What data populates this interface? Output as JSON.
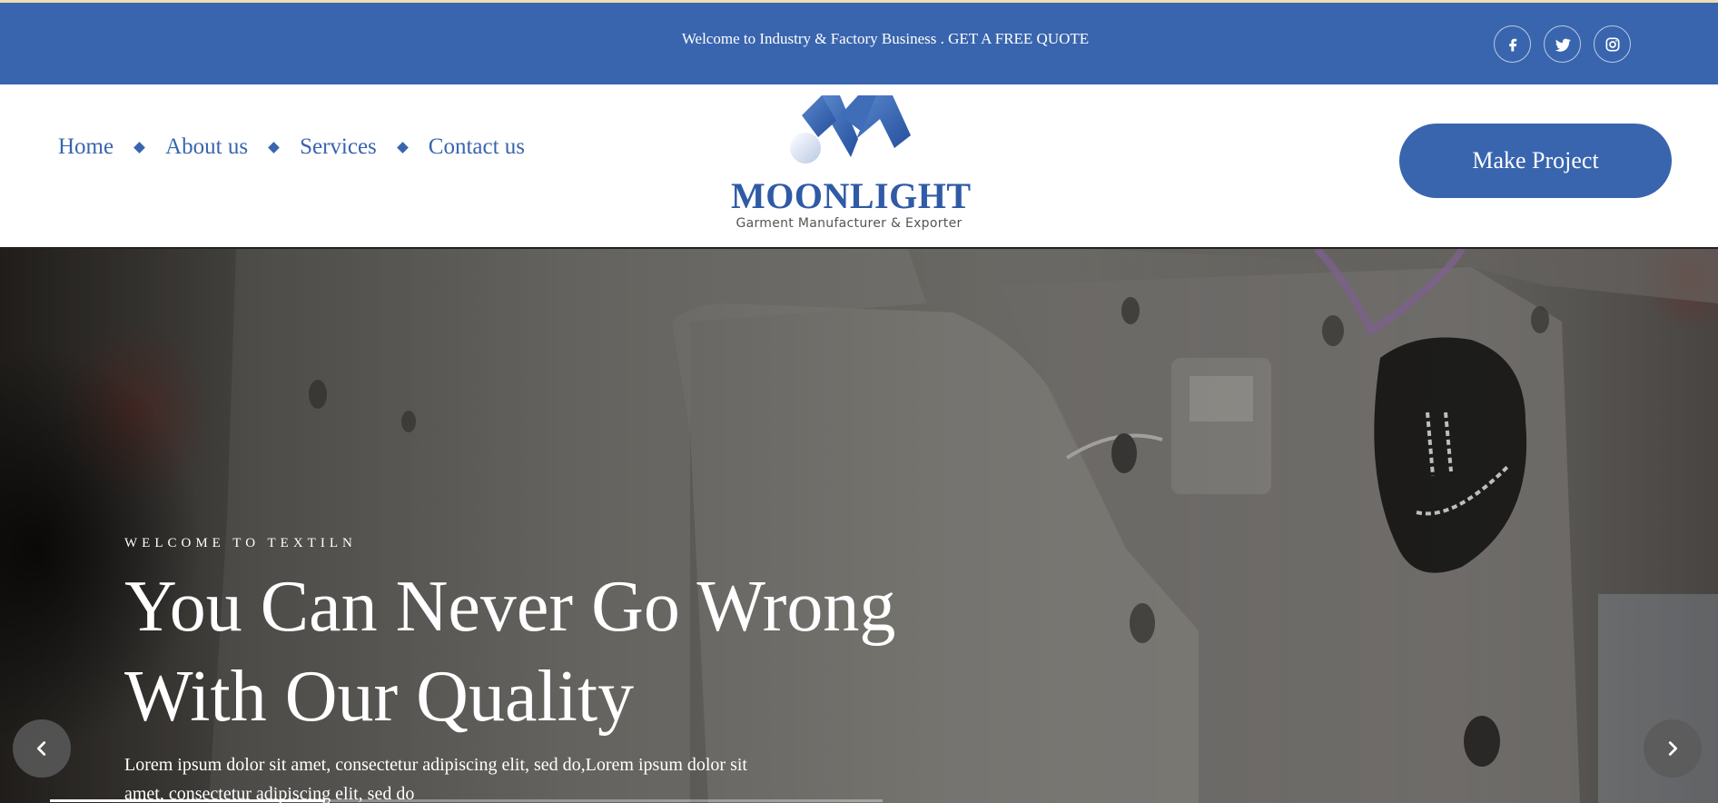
{
  "colors": {
    "brand": "#3965ae",
    "accent_strip": "#f0dcb4",
    "white": "#ffffff"
  },
  "topbar": {
    "text": "Welcome to Industry & Factory Business . GET A FREE QUOTE",
    "social": [
      {
        "icon": "facebook-icon"
      },
      {
        "icon": "twitter-icon"
      },
      {
        "icon": "instagram-icon"
      }
    ]
  },
  "nav": {
    "items": [
      {
        "label": "Home"
      },
      {
        "label": "About us"
      },
      {
        "label": "Services"
      },
      {
        "label": "Contact us"
      }
    ]
  },
  "logo": {
    "name": "MOONLIGHT",
    "tagline": "Garment Manufacturer & Exporter"
  },
  "header": {
    "cta_label": "Make Project"
  },
  "hero": {
    "eyebrow": "WELCOME TO TEXTILN",
    "title_line1": "You Can Never Go Wrong",
    "title_line2": "With Our Quality",
    "description": "Lorem ipsum dolor sit amet, consectetur adipiscing elit, sed do,Lorem ipsum dolor sit amet, consectetur adipiscing elit, sed do",
    "prev_icon": "chevron-left-icon",
    "next_icon": "chevron-right-icon",
    "slide_progress": 0.33
  }
}
